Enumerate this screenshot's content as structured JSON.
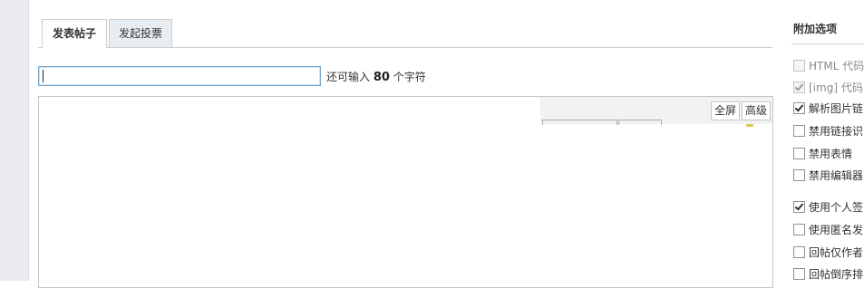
{
  "tabs": [
    {
      "label": "发表帖子",
      "active": true
    },
    {
      "label": "发起投票",
      "active": false
    }
  ],
  "subject": {
    "value": "",
    "counter_prefix": "还可输入",
    "counter_value": "80",
    "counter_suffix": "个字符"
  },
  "editor": {
    "fullscreen_label": "全屏",
    "advanced_label": "高级"
  },
  "sidebar": {
    "title": "附加选项",
    "options": [
      {
        "label": "HTML 代码",
        "checked": false,
        "disabled": true
      },
      {
        "label": "[img] 代码",
        "checked": true,
        "disabled": true
      },
      {
        "label": "解析图片链",
        "checked": true,
        "disabled": false
      },
      {
        "label": "禁用链接识",
        "checked": false,
        "disabled": false
      },
      {
        "label": "禁用表情",
        "checked": false,
        "disabled": false
      },
      {
        "label": "禁用编辑器",
        "checked": false,
        "disabled": false
      },
      {
        "label": "使用个人签",
        "checked": true,
        "disabled": false
      },
      {
        "label": "使用匿名发",
        "checked": false,
        "disabled": false
      },
      {
        "label": "回帖仅作者",
        "checked": false,
        "disabled": false
      },
      {
        "label": "回帖倒序排",
        "checked": false,
        "disabled": false
      }
    ]
  }
}
